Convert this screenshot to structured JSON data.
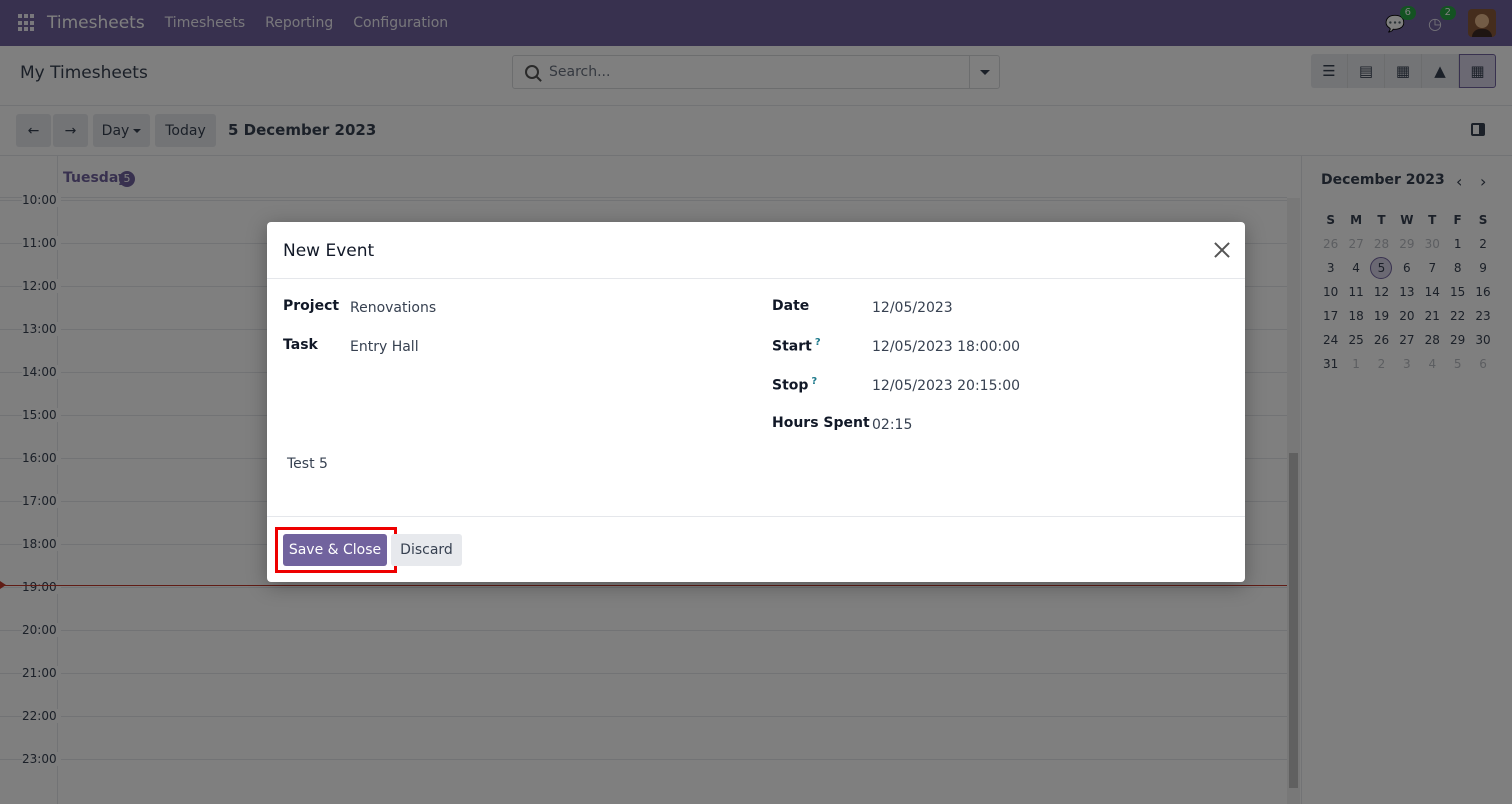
{
  "navbar": {
    "brand": "Timesheets",
    "menu": [
      "Timesheets",
      "Reporting",
      "Configuration"
    ],
    "messages_badge": "6",
    "activities_badge": "2"
  },
  "control": {
    "title": "My Timesheets",
    "search_placeholder": "Search...",
    "views": [
      "list-icon",
      "kanban-icon",
      "grid-icon",
      "graph-icon",
      "calendar-icon"
    ]
  },
  "toolbar": {
    "scale": "Day",
    "today": "Today",
    "date_label": "5 December 2023"
  },
  "calendar": {
    "day_name": "Tuesday",
    "day_num": "5",
    "hours": [
      "10:00",
      "11:00",
      "12:00",
      "13:00",
      "14:00",
      "15:00",
      "16:00",
      "17:00",
      "18:00",
      "19:00",
      "20:00",
      "21:00",
      "22:00",
      "23:00"
    ]
  },
  "mini_calendar": {
    "title": "December 2023",
    "weekdays": [
      "S",
      "M",
      "T",
      "W",
      "T",
      "F",
      "S"
    ],
    "weeks": [
      [
        "26",
        "27",
        "28",
        "29",
        "30",
        "1",
        "2"
      ],
      [
        "3",
        "4",
        "5",
        "6",
        "7",
        "8",
        "9"
      ],
      [
        "10",
        "11",
        "12",
        "13",
        "14",
        "15",
        "16"
      ],
      [
        "17",
        "18",
        "19",
        "20",
        "21",
        "22",
        "23"
      ],
      [
        "24",
        "25",
        "26",
        "27",
        "28",
        "29",
        "30"
      ],
      [
        "31",
        "1",
        "2",
        "3",
        "4",
        "5",
        "6"
      ]
    ]
  },
  "dialog": {
    "title": "New Event",
    "project_label": "Project",
    "project_value": "Renovations",
    "task_label": "Task",
    "task_value": "Entry Hall",
    "date_label": "Date",
    "date_value": "12/05/2023",
    "start_label": "Start",
    "start_value": "12/05/2023 18:00:00",
    "stop_label": "Stop",
    "stop_value": "12/05/2023 20:15:00",
    "hours_label": "Hours Spent",
    "hours_value": "02:15",
    "description": "Test 5",
    "help_mark": "?",
    "save_label": "Save & Close",
    "discard_label": "Discard"
  },
  "colors": {
    "brand": "#71639e",
    "highlight": "#ee0000",
    "now_line": "#c0392b"
  }
}
